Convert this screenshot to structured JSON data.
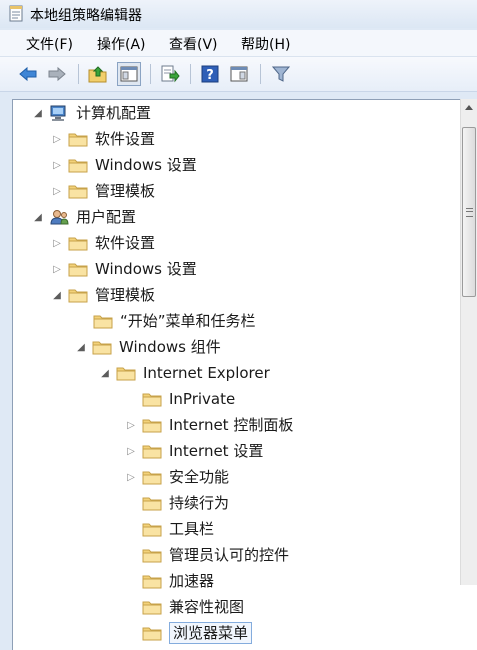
{
  "window": {
    "title": "本地组策略编辑器"
  },
  "menu": {
    "items": [
      "文件(F)",
      "操作(A)",
      "查看(V)",
      "帮助(H)"
    ]
  },
  "toolbar": {
    "buttons": [
      "back-icon",
      "forward-icon",
      "up-folder-icon",
      "show-hide-tree-icon",
      "export-list-icon",
      "help-icon",
      "properties-icon",
      "filter-icon"
    ]
  },
  "tree": {
    "items": [
      {
        "label": "计算机配置",
        "icon": "computer-icon",
        "state": "expanded"
      },
      {
        "label": "软件设置",
        "icon": "folder-icon",
        "state": "collapsed"
      },
      {
        "label": "Windows 设置",
        "icon": "folder-icon",
        "state": "collapsed"
      },
      {
        "label": "管理模板",
        "icon": "folder-icon",
        "state": "collapsed"
      },
      {
        "label": "用户配置",
        "icon": "user-icon",
        "state": "expanded"
      },
      {
        "label": "软件设置",
        "icon": "folder-icon",
        "state": "collapsed"
      },
      {
        "label": "Windows 设置",
        "icon": "folder-icon",
        "state": "collapsed"
      },
      {
        "label": "管理模板",
        "icon": "folder-icon",
        "state": "expanded"
      },
      {
        "label": "“开始”菜单和任务栏",
        "icon": "folder-icon",
        "state": "leaf"
      },
      {
        "label": "Windows 组件",
        "icon": "folder-icon",
        "state": "expanded"
      },
      {
        "label": "Internet Explorer",
        "icon": "folder-icon",
        "state": "expanded"
      },
      {
        "label": "InPrivate",
        "icon": "folder-icon",
        "state": "leaf"
      },
      {
        "label": "Internet 控制面板",
        "icon": "folder-icon",
        "state": "collapsed"
      },
      {
        "label": "Internet 设置",
        "icon": "folder-icon",
        "state": "collapsed"
      },
      {
        "label": "安全功能",
        "icon": "folder-icon",
        "state": "collapsed"
      },
      {
        "label": "持续行为",
        "icon": "folder-icon",
        "state": "leaf"
      },
      {
        "label": "工具栏",
        "icon": "folder-icon",
        "state": "leaf"
      },
      {
        "label": "管理员认可的控件",
        "icon": "folder-icon",
        "state": "leaf"
      },
      {
        "label": "加速器",
        "icon": "folder-icon",
        "state": "leaf"
      },
      {
        "label": "兼容性视图",
        "icon": "folder-icon",
        "state": "leaf"
      },
      {
        "label": "浏览器菜单",
        "icon": "folder-icon",
        "state": "leaf",
        "selected": true
      }
    ]
  }
}
